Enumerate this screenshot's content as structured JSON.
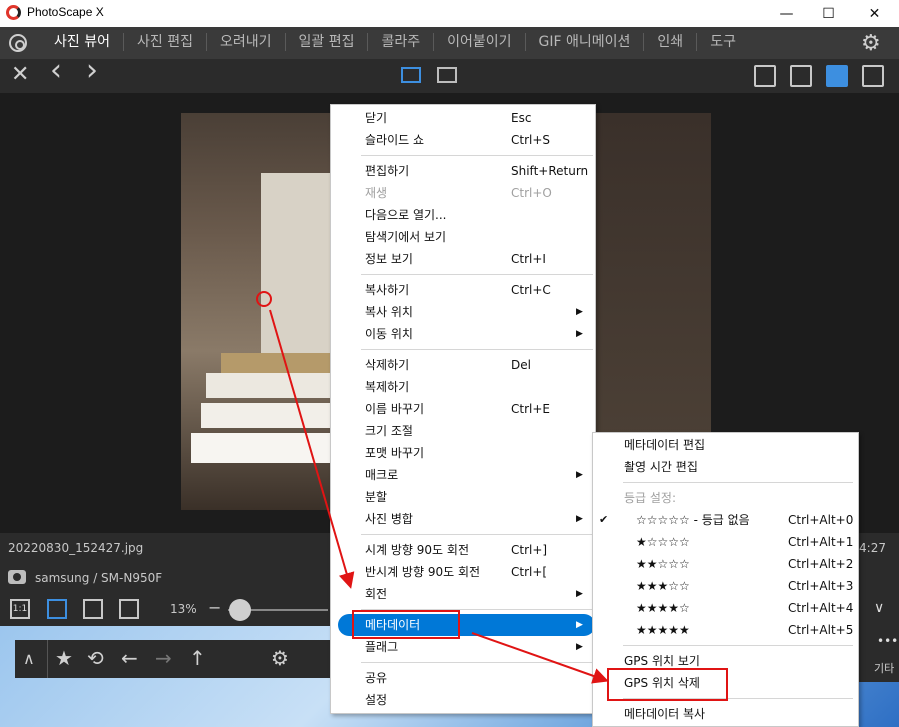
{
  "window": {
    "title": "PhotoScape X",
    "minimize": "—",
    "maximize": "☐",
    "close": "✕"
  },
  "tabs": [
    {
      "label": "사진 뷰어",
      "active": true
    },
    {
      "label": "사진 편집"
    },
    {
      "label": "오려내기"
    },
    {
      "label": "일괄 편집"
    },
    {
      "label": "콜라주"
    },
    {
      "label": "이어붙이기"
    },
    {
      "label": "GIF 애니메이션"
    },
    {
      "label": "인쇄"
    },
    {
      "label": "도구"
    }
  ],
  "toolbar": {
    "close_glyph": "✕",
    "prev_glyph": "‹",
    "next_glyph": "›"
  },
  "viewer": {
    "filename": "20220830_152427.jpg",
    "time_partial": "24:27",
    "camera": "samsung / SM-N950F"
  },
  "zoom": {
    "value": "13%",
    "minus": "−",
    "btn_1to1": "1:1",
    "down": "∨"
  },
  "bottom": {
    "star": "★",
    "rotate": "⟲",
    "back": "←",
    "forward": "→",
    "up": "↑",
    "gear": "⚙",
    "dots": "•••",
    "other_label": "기타"
  },
  "context_menu": {
    "items": [
      {
        "label": "닫기",
        "shortcut": "Esc"
      },
      {
        "label": "슬라이드 쇼",
        "shortcut": "Ctrl+S"
      },
      {
        "label": "편집하기",
        "shortcut": "Shift+Return"
      },
      {
        "label": "재생",
        "shortcut": "Ctrl+O",
        "disabled": true
      },
      {
        "label": "다음으로 열기...",
        "shortcut": ""
      },
      {
        "label": "탐색기에서 보기",
        "shortcut": ""
      },
      {
        "label": "정보 보기",
        "shortcut": "Ctrl+I"
      },
      {
        "label": "복사하기",
        "shortcut": "Ctrl+C"
      },
      {
        "label": "복사 위치",
        "shortcut": "",
        "submenu": true
      },
      {
        "label": "이동 위치",
        "shortcut": "",
        "submenu": true
      },
      {
        "label": "삭제하기",
        "shortcut": "Del"
      },
      {
        "label": "복제하기",
        "shortcut": ""
      },
      {
        "label": "이름 바꾸기",
        "shortcut": "Ctrl+E"
      },
      {
        "label": "크기 조절",
        "shortcut": ""
      },
      {
        "label": "포맷 바꾸기",
        "shortcut": ""
      },
      {
        "label": "매크로",
        "shortcut": "",
        "submenu": true
      },
      {
        "label": "분할",
        "shortcut": ""
      },
      {
        "label": "사진 병합",
        "shortcut": "",
        "submenu": true
      },
      {
        "label": "시계 방향 90도 회전",
        "shortcut": "Ctrl+]"
      },
      {
        "label": "반시계 방향 90도 회전",
        "shortcut": "Ctrl+["
      },
      {
        "label": "회전",
        "shortcut": "",
        "submenu": true
      },
      {
        "label": "메타데이터",
        "shortcut": "",
        "submenu": true,
        "highlighted": true
      },
      {
        "label": "플래그",
        "shortcut": "",
        "submenu": true
      },
      {
        "label": "공유",
        "shortcut": ""
      },
      {
        "label": "설정",
        "shortcut": ""
      }
    ],
    "submenu_arrow": "▶"
  },
  "metadata_submenu": {
    "items": [
      {
        "label": "메타데이터 편집",
        "shortcut": ""
      },
      {
        "label": "촬영 시간 편집",
        "shortcut": ""
      },
      {
        "label": "등급 설정:",
        "shortcut": "",
        "disabled": true
      },
      {
        "label": "☆☆☆☆☆ - 등급 없음",
        "shortcut": "Ctrl+Alt+0",
        "checked": true
      },
      {
        "label": "★☆☆☆☆",
        "shortcut": "Ctrl+Alt+1"
      },
      {
        "label": "★★☆☆☆",
        "shortcut": "Ctrl+Alt+2"
      },
      {
        "label": "★★★☆☆",
        "shortcut": "Ctrl+Alt+3"
      },
      {
        "label": "★★★★☆",
        "shortcut": "Ctrl+Alt+4"
      },
      {
        "label": "★★★★★",
        "shortcut": "Ctrl+Alt+5"
      },
      {
        "label": "GPS 위치 보기",
        "shortcut": ""
      },
      {
        "label": "GPS 위치 삭제",
        "shortcut": ""
      },
      {
        "label": "메타데이터 복사",
        "shortcut": ""
      }
    ],
    "check_glyph": "✔"
  },
  "colors": {
    "accent": "#0078d7",
    "annotation_red": "#e01414",
    "tab_bg": "#3a3a3a",
    "active_blue": "#3d8fe0"
  }
}
